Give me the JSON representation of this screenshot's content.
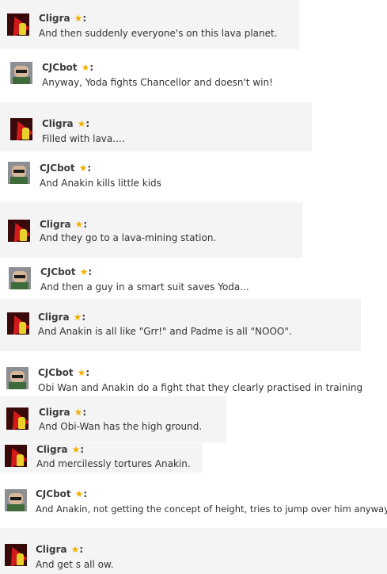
{
  "messages": [
    {
      "user": "Cligra",
      "text": "And then suddenly everyone's on this lava planet."
    },
    {
      "user": "CJCbot",
      "text": "Anyway, Yoda fights Chancellor and doesn't win!"
    },
    {
      "user": "Cligra",
      "text": "Filled with lava...."
    },
    {
      "user": "CJCbot",
      "text": "And Anakin kills little kids"
    },
    {
      "user": "Cligra",
      "text": "And they go to a lava-mining station."
    },
    {
      "user": "CJCbot",
      "text": "And then a guy in a smart suit saves Yoda..."
    },
    {
      "user": "Cligra",
      "text": "And Anakin is all like \"Grr!\" and Padme is all \"NOOO\"."
    },
    {
      "user": "CJCbot",
      "text": "Obi Wan and Anakin do a fight that they clearly practised in training"
    },
    {
      "user": "Cligra",
      "text": "And Obi-Wan has the high ground."
    },
    {
      "user": "Cligra",
      "text": "And mercilessly tortures Anakin."
    },
    {
      "user": "CJCbot",
      "text": "And Anakin, not getting the concept of height, tries to jump over him anyway"
    },
    {
      "user": "Cligra",
      "text": "And get s all ow."
    }
  ],
  "colon": ":",
  "star": "★",
  "colors": {
    "panel": "#f4f4f4",
    "star": "#f0b000",
    "name": "#3c3c3c"
  },
  "icons": {
    "cligra_avatar": "cligra-avatar",
    "cjcbot_avatar": "cjcbot-avatar",
    "star": "star-icon"
  }
}
